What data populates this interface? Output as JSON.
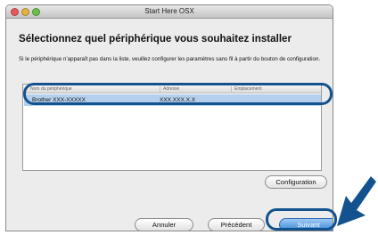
{
  "window": {
    "title": "Start Here OSX"
  },
  "heading": "Sélectionnez quel périphérique vous souhaitez installer",
  "instructions": "Si le périphérique n’apparaît pas dans la liste, veuillez configurer les paramètres sans fil à partir du bouton de configuration.",
  "table": {
    "columns": [
      "Nom du périphérique",
      "Adresse",
      "Emplacement"
    ],
    "rows": [
      {
        "name": "Brother XXX-XXXXX",
        "address": "XXX.XXX.X.X"
      }
    ]
  },
  "buttons": {
    "configuration": "Configuration",
    "cancel": "Annuler",
    "previous": "Précédent",
    "next": "Suivant"
  },
  "colors": {
    "highlight": "#13528e",
    "selection": "#b5d0ec",
    "primary_button": "#3a88d6"
  }
}
